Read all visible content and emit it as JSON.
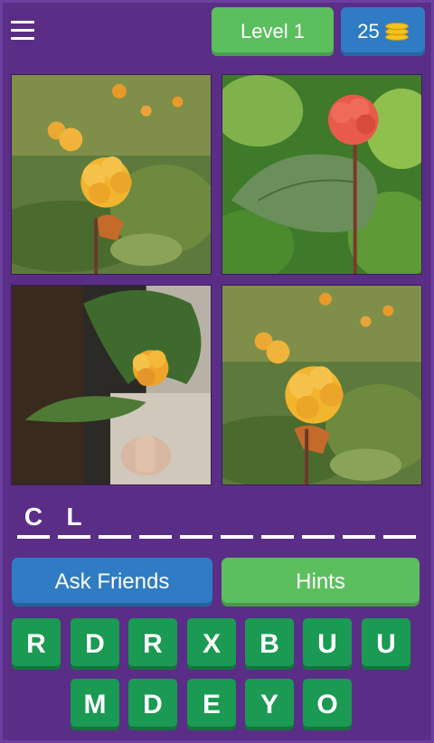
{
  "header": {
    "menu_icon": "hamburger-menu-icon",
    "level_label": "Level 1",
    "coins": "25",
    "coin_icon": "coin-stack-icon"
  },
  "images": [
    {
      "subject": "cloudberry"
    },
    {
      "subject": "cloudberry"
    },
    {
      "subject": "cloudberry"
    },
    {
      "subject": "cloudberry"
    }
  ],
  "answer": {
    "slots": [
      "C",
      "L",
      "",
      "",
      "",
      "",
      "",
      "",
      "",
      ""
    ]
  },
  "actions": {
    "ask_friends_label": "Ask Friends",
    "hints_label": "Hints"
  },
  "letters": {
    "row1": [
      "R",
      "D",
      "R",
      "X",
      "B",
      "U",
      "U"
    ],
    "row2": [
      "M",
      "D",
      "E",
      "Y",
      "O"
    ]
  },
  "colors": {
    "background": "#5a2e86",
    "green": "#5cbf5e",
    "blue": "#2f7cc4",
    "tile_green": "#1a9a52"
  }
}
